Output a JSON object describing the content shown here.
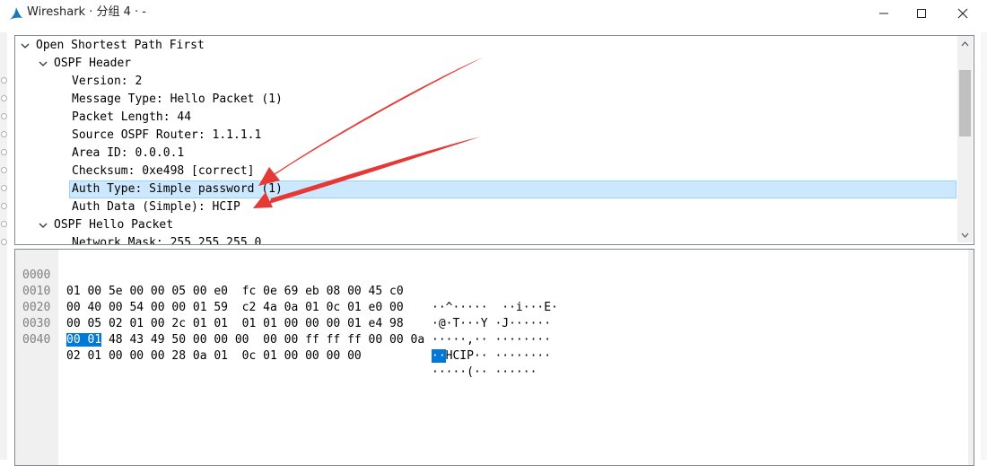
{
  "window": {
    "title": "Wireshark · 分组 4 · -"
  },
  "tree": {
    "rows": [
      {
        "label": "Open Shortest Path First"
      },
      {
        "label": "OSPF Header"
      },
      {
        "label": "Version: 2"
      },
      {
        "label": "Message Type: Hello Packet (1)"
      },
      {
        "label": "Packet Length: 44"
      },
      {
        "label": "Source OSPF Router: 1.1.1.1"
      },
      {
        "label": "Area ID: 0.0.0.1"
      },
      {
        "label": "Checksum: 0xe498 [correct]"
      },
      {
        "label": "Auth Type: Simple password (1)"
      },
      {
        "label": "Auth Data (Simple): HCIP"
      },
      {
        "label": "OSPF Hello Packet"
      },
      {
        "label": "Network Mask: 255.255.255.0"
      }
    ],
    "selected_row": "Auth Type: Simple password (1)"
  },
  "hex": {
    "lines": [
      {
        "offset": "0000",
        "bytes": "01 00 5e 00 00 05 00 e0  fc 0e 69 eb 08 00 45 c0",
        "ascii": "··^·····  ··i···E·"
      },
      {
        "offset": "0010",
        "bytes": "00 40 00 54 00 00 01 59  c2 4a 0a 01 0c 01 e0 00",
        "ascii": "·@·T···Y ·J······"
      },
      {
        "offset": "0020",
        "bytes": "00 05 02 01 00 2c 01 01  01 01 00 00 00 01 e4 98",
        "ascii": "·····,·· ········"
      },
      {
        "offset": "0030",
        "bytes_hl": "00 01",
        "bytes_rest": " 48 43 49 50 00 00 00  00 00 ff ff ff 00 00 0a",
        "ascii_hl": "··",
        "ascii_rest": "HCIP·· ········"
      },
      {
        "offset": "0040",
        "bytes": "02 01 00 00 00 28 0a 01  0c 01 00 00 00 00",
        "ascii": "·····(·· ······"
      }
    ]
  },
  "colors": {
    "selection_bg": "#cce8ff",
    "hex_highlight": "#0078d7",
    "annotation_arrow": "#e53935"
  }
}
